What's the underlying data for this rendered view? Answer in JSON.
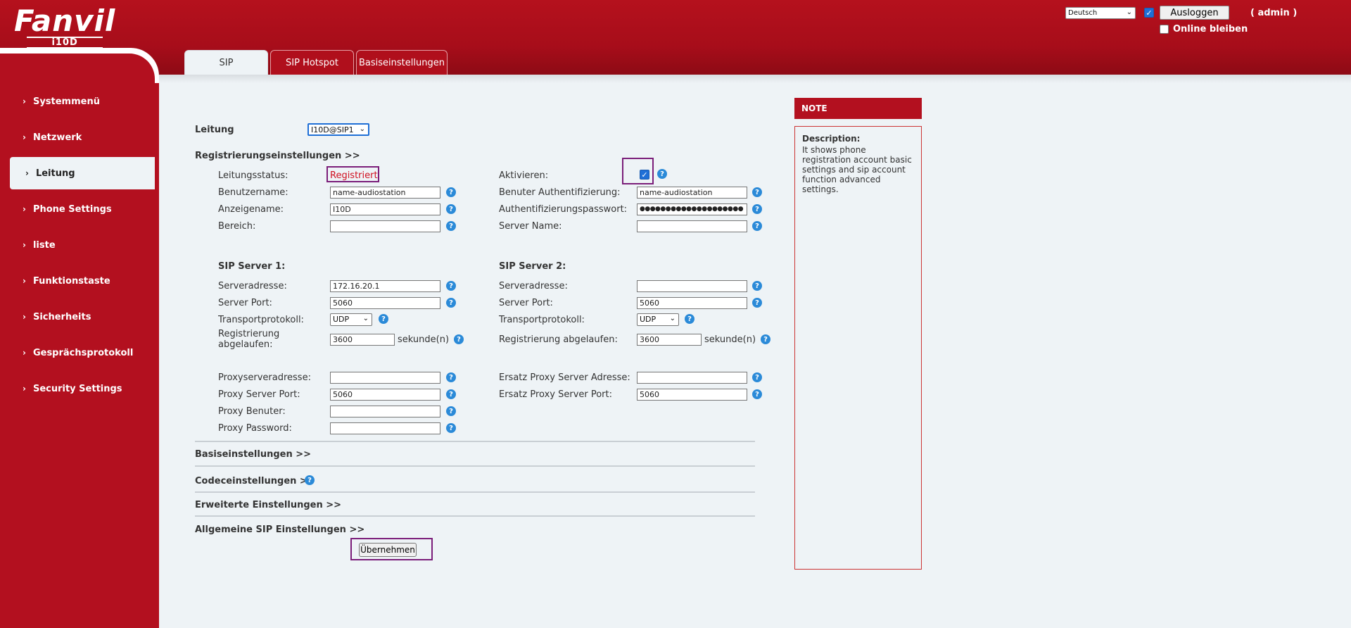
{
  "header": {
    "brand": "Fanvil",
    "model": "i10D",
    "language": "Deutsch",
    "logout_label": "Ausloggen",
    "user_label": "( admin )",
    "stay_online_label": "Online bleiben"
  },
  "tabs": [
    {
      "label": "SIP",
      "active": true
    },
    {
      "label": "SIP Hotspot",
      "active": false
    },
    {
      "label": "Basiseinstellungen",
      "active": false
    }
  ],
  "sidebar": {
    "items": [
      {
        "label": "Systemmenü"
      },
      {
        "label": "Netzwerk"
      },
      {
        "label": "Leitung",
        "active": true
      },
      {
        "label": "Phone Settings"
      },
      {
        "label": "liste"
      },
      {
        "label": "Funktionstaste"
      },
      {
        "label": "Sicherheits"
      },
      {
        "label": "Gesprächsprotokoll"
      },
      {
        "label": "Security Settings"
      }
    ]
  },
  "form": {
    "line_label": "Leitung",
    "line_value": "I10D@SIP1",
    "registration_section": "Registrierungseinstellungen >>",
    "line_status_label": "Leitungsstatus:",
    "line_status_value": "Registriert",
    "activate_label": "Aktivieren:",
    "username_label": "Benutzername:",
    "username_value": "name-audiostation",
    "auth_user_label": "Benuter Authentifizierung:",
    "auth_user_value": "name-audiostation",
    "display_name_label": "Anzeigename:",
    "display_name_value": "I10D",
    "auth_password_label": "Authentifizierungspasswort:",
    "auth_password_value": "●●●●●●●●●●●●●●●●●●●●",
    "realm_label": "Bereich:",
    "realm_value": "",
    "server_name_label": "Server Name:",
    "server_name_value": "",
    "sip_server1_title": "SIP Server 1:",
    "sip_server2_title": "SIP Server 2:",
    "server_address_label": "Serveradresse:",
    "server1_address_value": "172.16.20.1",
    "server2_address_value": "",
    "server_port_label": "Server Port:",
    "server1_port_value": "5060",
    "server2_port_value": "5060",
    "transport_label": "Transportprotokoll:",
    "transport1_value": "UDP",
    "transport2_value": "UDP",
    "reg_expire_label_left": "Registrierung abgelaufen:",
    "reg_expire_label_right": "Registrierung abgelaufen:",
    "reg_expire1_value": "3600",
    "reg_expire2_value": "3600",
    "seconds_unit": "sekunde(n)",
    "proxy_address_label": "Proxyserveradresse:",
    "proxy_address_value": "",
    "backup_proxy_address_label": "Ersatz Proxy Server Adresse:",
    "backup_proxy_address_value": "",
    "proxy_port_label": "Proxy Server Port:",
    "proxy_port_value": "5060",
    "backup_proxy_port_label": "Ersatz Proxy Server Port:",
    "backup_proxy_port_value": "5060",
    "proxy_user_label": "Proxy Benuter:",
    "proxy_user_value": "",
    "proxy_password_label": "Proxy Password:",
    "proxy_password_value": "",
    "basic_settings_section": "Basiseinstellungen >>",
    "codec_settings_section": "Codeceinstellungen >>",
    "advanced_settings_section": "Erweiterte Einstellungen >>",
    "general_sip_section": "Allgemeine SIP Einstellungen >>",
    "apply_label": "Übernehmen"
  },
  "note": {
    "title": "NOTE",
    "description_title": "Description:",
    "description_text": "It shows phone registration account basic settings and sip account function advanced settings."
  },
  "colors": {
    "brand_red": "#b3101f",
    "content_bg": "#eef3f6",
    "status_red": "#d01020",
    "help_blue": "#2b8ad8",
    "highlight_purple": "#7b1e7a"
  }
}
